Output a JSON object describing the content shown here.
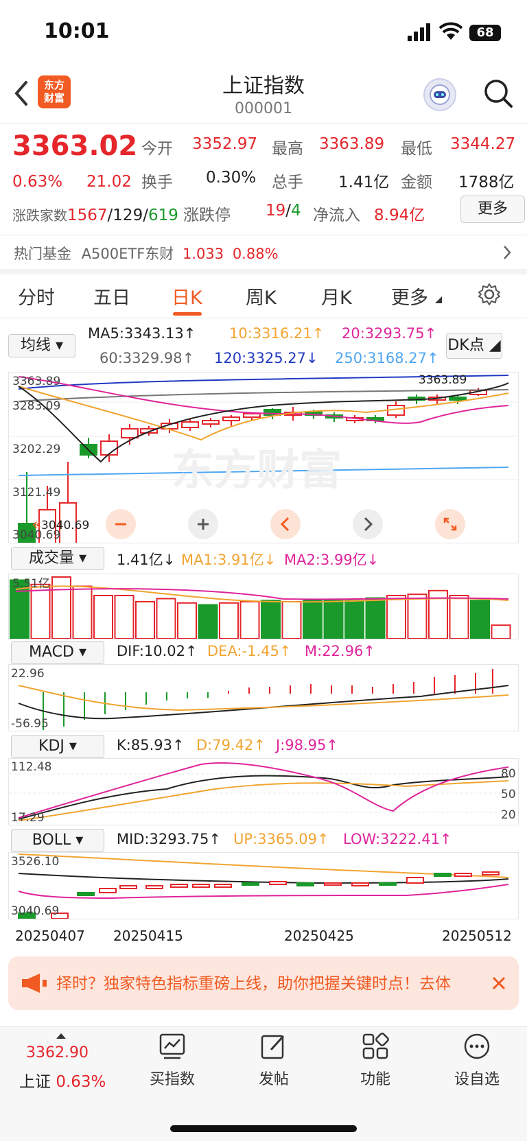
{
  "status_bar": {
    "time": "10:01",
    "battery": "68"
  },
  "header": {
    "title": "上证指数",
    "code": "000001",
    "logo_text": "东方财富"
  },
  "quote": {
    "price": "3363.02",
    "change_pct": "0.63%",
    "change": "21.02",
    "open_label": "今开",
    "open": "3352.97",
    "high_label": "最高",
    "high": "3363.89",
    "low_label": "最低",
    "low": "3344.27",
    "turnover_label": "换手",
    "turnover": "0.30%",
    "volume_label": "总手",
    "volume": "1.41亿",
    "amount_label": "金额",
    "amount": "1788亿",
    "breadth_label": "涨跌家数",
    "breadth_up": "1567",
    "breadth_flat": "129",
    "breadth_down": "619",
    "breadth_sep": "/",
    "limit_label": "涨跌停",
    "limit_up": "19",
    "limit_down": "4",
    "inflow_label": "净流入",
    "inflow": "8.94亿",
    "more_label": "更多"
  },
  "hot_fund": {
    "label": "热门基金",
    "name": "A500ETF东财",
    "price": "1.033",
    "pct": "0.88%"
  },
  "tabs": [
    "分时",
    "五日",
    "日K",
    "周K",
    "月K",
    "更多"
  ],
  "active_tab": 2,
  "ma": {
    "selector": "均线",
    "ma5": "MA5:3343.13↑",
    "ma10": "10:3316.21↑",
    "ma20": "20:3293.75↑",
    "ma60": "60:3329.98↑",
    "ma120": "120:3325.27↓",
    "ma250": "250:3168.27↑",
    "dk": "DK点"
  },
  "kline": {
    "y_labels": [
      "3363.89",
      "3283.09",
      "3202.29",
      "3121.49",
      "3040.69"
    ],
    "high_marker": "3363.89",
    "low_marker": "3040.69",
    "watermark": "东方财富"
  },
  "volume": {
    "selector": "成交量",
    "value": "1.41亿↓",
    "ma1": "MA1:3.91亿↓",
    "ma2": "MA2:3.99亿↓",
    "max_label": "5.51亿"
  },
  "macd": {
    "selector": "MACD",
    "dif": "DIF:10.02↑",
    "dea": "DEA:-1.45↑",
    "m": "M:22.96↑",
    "top": "22.96",
    "bottom": "-56.95"
  },
  "kdj": {
    "selector": "KDJ",
    "k": "K:85.93↑",
    "d": "D:79.42↑",
    "j": "J:98.95↑",
    "top": "112.48",
    "bottom": "17.29",
    "levels": [
      "80",
      "50",
      "20"
    ]
  },
  "boll": {
    "selector": "BOLL",
    "mid": "MID:3293.75↑",
    "up": "UP:3365.09↑",
    "low": "LOW:3222.41↑",
    "top": "3526.10",
    "bottom": "3040.69"
  },
  "dates": [
    "20250407",
    "20250415",
    "20250425",
    "20250512"
  ],
  "banner": {
    "text": "择时？独家特色指标重磅上线，助你把握关键时点！去体"
  },
  "bottom_nav": {
    "price": "3362.90",
    "index_name": "上证",
    "index_pct": "0.63%",
    "items": [
      "买指数",
      "发帖",
      "功能",
      "设自选"
    ]
  },
  "colors": {
    "up": "#e5262b",
    "down": "#1a9a2a",
    "accent": "#f15a22"
  }
}
